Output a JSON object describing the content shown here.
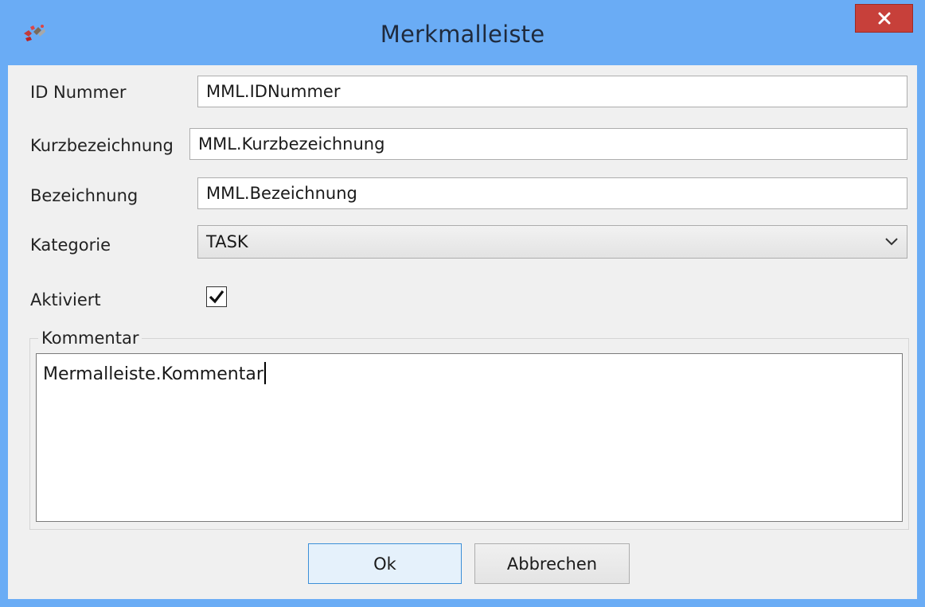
{
  "window": {
    "title": "Merkmalleiste",
    "app_icon": "app-logo-icon",
    "close_icon": "close-icon"
  },
  "form": {
    "id_label": "ID Nummer",
    "id_value": "MML.IDNummer",
    "short_label": "Kurzbezeichnung",
    "short_value": "MML.Kurzbezeichnung",
    "name_label": "Bezeichnung",
    "name_value": "MML.Bezeichnung",
    "category_label": "Kategorie",
    "category_value": "TASK",
    "active_label": "Aktiviert",
    "active_checked": true
  },
  "comment": {
    "legend": "Kommentar",
    "text": "Mermalleiste.Kommentar"
  },
  "buttons": {
    "ok": "Ok",
    "cancel": "Abbrechen"
  },
  "colors": {
    "frame": "#6aacf5",
    "close": "#c7403a",
    "default_button_border": "#3c8fd8"
  }
}
